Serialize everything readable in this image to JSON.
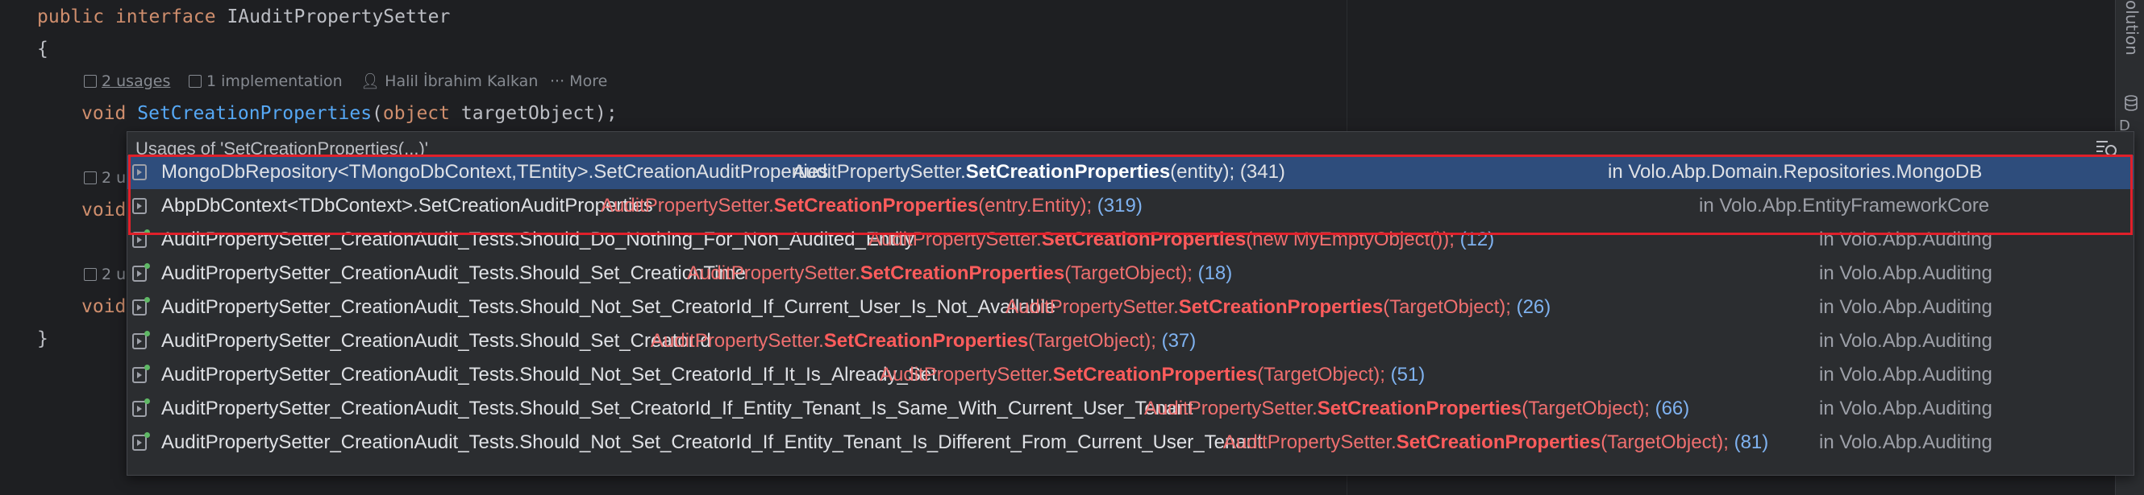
{
  "editor": {
    "line1": {
      "kw1": "public",
      "kw2": "interface",
      "name": "IAuditPropertySetter"
    },
    "brace_open": "{",
    "hints": {
      "usages": "2 usages",
      "implementation": "1 implementation",
      "author": "Halil İbrahim Kalkan",
      "more": "More"
    },
    "method_line": {
      "type": "void",
      "name": "SetCreationProperties",
      "paren_open": "(",
      "param_type": "object",
      "param_name": "targetObject",
      "paren_close": ");"
    },
    "partial_hint1": "2 u",
    "partial_void1": "void",
    "partial_hint2": "2 u",
    "partial_void2": "void",
    "brace_close": "}"
  },
  "tool_strip": {
    "label": "olution",
    "label2": "D"
  },
  "popup": {
    "title": "Usages of 'SetCreationProperties(...)'",
    "rows": [
      {
        "name": "MongoDbRepository<TMongoDbContext,TEntity>.SetCreationAuditProperties",
        "pre": "AuditPropertySetter.",
        "method": "SetCreationProperties",
        "args": "(entity);",
        "line": "(341)",
        "module": "in Volo.Abp.Domain.Repositories.MongoDB",
        "selected": true
      },
      {
        "name": "AbpDbContext<TDbContext>.SetCreationAuditProperties",
        "pre": "AuditPropertySetter.",
        "method": "SetCreationProperties",
        "args": "(entry.Entity);",
        "line": "(319)",
        "module": "in Volo.Abp.EntityFrameworkCore"
      },
      {
        "name": "AuditPropertySetter_CreationAudit_Tests.Should_Do_Nothing_For_Non_Audited_Entity",
        "pre": "AuditPropertySetter.",
        "method": "SetCreationProperties",
        "args": "(new MyEmptyObject());",
        "line": "(12)",
        "module": "in Volo.Abp.Auditing"
      },
      {
        "name": "AuditPropertySetter_CreationAudit_Tests.Should_Set_CreationTime",
        "pre": "AuditPropertySetter.",
        "method": "SetCreationProperties",
        "args": "(TargetObject);",
        "line": "(18)",
        "module": "in Volo.Abp.Auditing"
      },
      {
        "name": "AuditPropertySetter_CreationAudit_Tests.Should_Not_Set_CreatorId_If_Current_User_Is_Not_Available",
        "pre": "AuditPropertySetter.",
        "method": "SetCreationProperties",
        "args": "(TargetObject);",
        "line": "(26)",
        "module": "in Volo.Abp.Auditing"
      },
      {
        "name": "AuditPropertySetter_CreationAudit_Tests.Should_Set_CreatorId",
        "pre": "AuditPropertySetter.",
        "method": "SetCreationProperties",
        "args": "(TargetObject);",
        "line": "(37)",
        "module": "in Volo.Abp.Auditing"
      },
      {
        "name": "AuditPropertySetter_CreationAudit_Tests.Should_Not_Set_CreatorId_If_It_Is_Already_Set",
        "pre": "AuditPropertySetter.",
        "method": "SetCreationProperties",
        "args": "(TargetObject);",
        "line": "(51)",
        "module": "in Volo.Abp.Auditing"
      },
      {
        "name": "AuditPropertySetter_CreationAudit_Tests.Should_Set_CreatorId_If_Entity_Tenant_Is_Same_With_Current_User_Tenant",
        "pre": "AuditPropertySetter.",
        "method": "SetCreationProperties",
        "args": "(TargetObject);",
        "line": "(66)",
        "module": "in Volo.Abp.Auditing"
      },
      {
        "name": "AuditPropertySetter_CreationAudit_Tests.Should_Not_Set_CreatorId_If_Entity_Tenant_Is_Different_From_Current_User_Tenant",
        "pre": "AuditPropertySetter.",
        "method": "SetCreationProperties",
        "args": "(TargetObject);",
        "line": "(81)",
        "module": "in Volo.Abp.Auditing"
      }
    ]
  },
  "colors": {
    "selection": "#2e4d7c",
    "highlight_box": "#e0202a",
    "usage_text": "#ef6f6f",
    "line_number": "#7fb2f0"
  }
}
